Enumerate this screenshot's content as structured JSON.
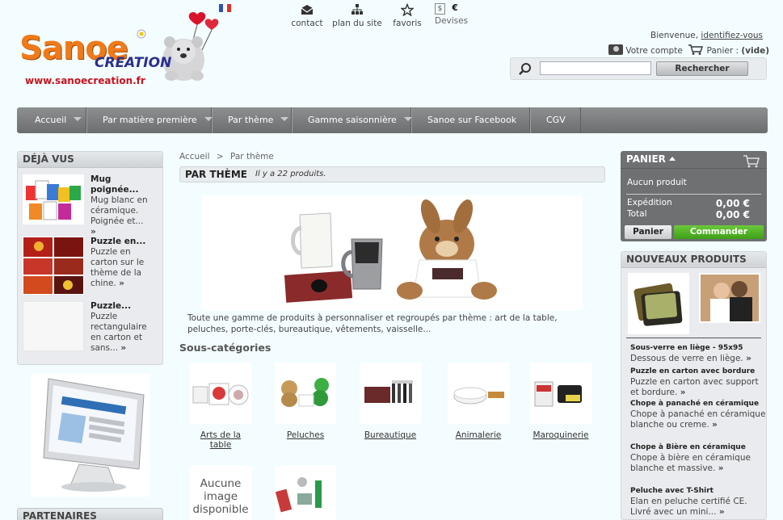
{
  "header": {
    "top_links": [
      {
        "label": "contact",
        "icon": "envelope-icon"
      },
      {
        "label": "plan du site",
        "icon": "sitemap-icon"
      },
      {
        "label": "favoris",
        "icon": "star-icon"
      },
      {
        "label": "Devises",
        "icon": "dollar-icon",
        "symbol": "$",
        "currency": "€"
      }
    ],
    "logo_top": "Sanoe",
    "logo_sub": "CREATION",
    "logo_url": "www.sanoecreation.fr",
    "welcome": "Bienvenue,",
    "login_link": "identifiez-vous",
    "account_label": "Votre compte",
    "cart_label": "Panier :",
    "cart_state": "(vide)",
    "search": {
      "value": "",
      "button": "Rechercher"
    }
  },
  "menu": {
    "items": [
      {
        "label": "Accueil",
        "has_arrow": true
      },
      {
        "label": "Par matière première",
        "has_arrow": true
      },
      {
        "label": "Par thème",
        "has_arrow": true
      },
      {
        "label": "Gamme saisonnière",
        "has_arrow": true
      },
      {
        "label": "Sanoe sur Facebook",
        "has_arrow": false
      },
      {
        "label": "CGV",
        "has_arrow": false
      }
    ]
  },
  "left": {
    "viewed_title": "DÉJÀ VUS",
    "viewed": [
      {
        "title": "Mug poignée...",
        "desc": "Mug blanc en céramique. Poignée et...",
        "more": "»"
      },
      {
        "title": "Puzzle en...",
        "desc": "Puzzle en carton sur le thème de la chine.",
        "more": "»"
      },
      {
        "title": "Puzzle...",
        "desc": "Puzzle rectangulaire en carton et sans...",
        "more": "»"
      }
    ],
    "partners_title": "PARTENAIRES"
  },
  "center": {
    "breadcrumb_home": "Accueil",
    "breadcrumb_sep": ">",
    "breadcrumb_current": "Par thème",
    "category_title": "PAR THÈME",
    "product_count": "Il y a 22 produits.",
    "description": "Toute une gamme de produits à personnaliser et regroupés par thème : art de la table, peluches, porte-clés, bureautique, vêtements, vaisselle...",
    "subcategories_title": "Sous-catégories",
    "subcategories": [
      {
        "label": "Arts de la table"
      },
      {
        "label": "Peluches"
      },
      {
        "label": "Bureautique"
      },
      {
        "label": "Animalerie"
      },
      {
        "label": "Maroquinerie"
      },
      {
        "label": ""
      },
      {
        "label": ""
      }
    ],
    "no_image_text": "Aucune image disponible"
  },
  "right": {
    "cart_title": "PANIER",
    "cart_empty": "Aucun produit",
    "shipping_label": "Expédition",
    "shipping_value": "0,00 €",
    "total_label": "Total",
    "total_value": "0,00 €",
    "cart_button": "Panier",
    "order_button": "Commander",
    "new_title": "NOUVEAUX PRODUITS",
    "new_products": [
      {
        "title": "Sous-verre en liège - 95x95",
        "desc": "Dessous de verre en liège.",
        "more": "»"
      },
      {
        "title": "Puzzle en carton avec bordure",
        "desc": "Puzzle en carton avec support et bordure.",
        "more": "»"
      },
      {
        "title": "Chope à panaché en céramique",
        "desc": "Chope à panaché en céramique blanche ou creme.",
        "more": "»"
      },
      {
        "title": "Chope à Bière en céramique",
        "desc": "Chope à bière en céramique blanche et massive.",
        "more": "»"
      },
      {
        "title": "Peluche avec T-Shirt",
        "desc": "Elan en peluche certifié CE. Livré avec un mini...",
        "more": "»"
      }
    ]
  },
  "colors": {
    "menu": "#7b7d7f",
    "order_button": "#4caf1e",
    "background": "#f3fdff"
  }
}
